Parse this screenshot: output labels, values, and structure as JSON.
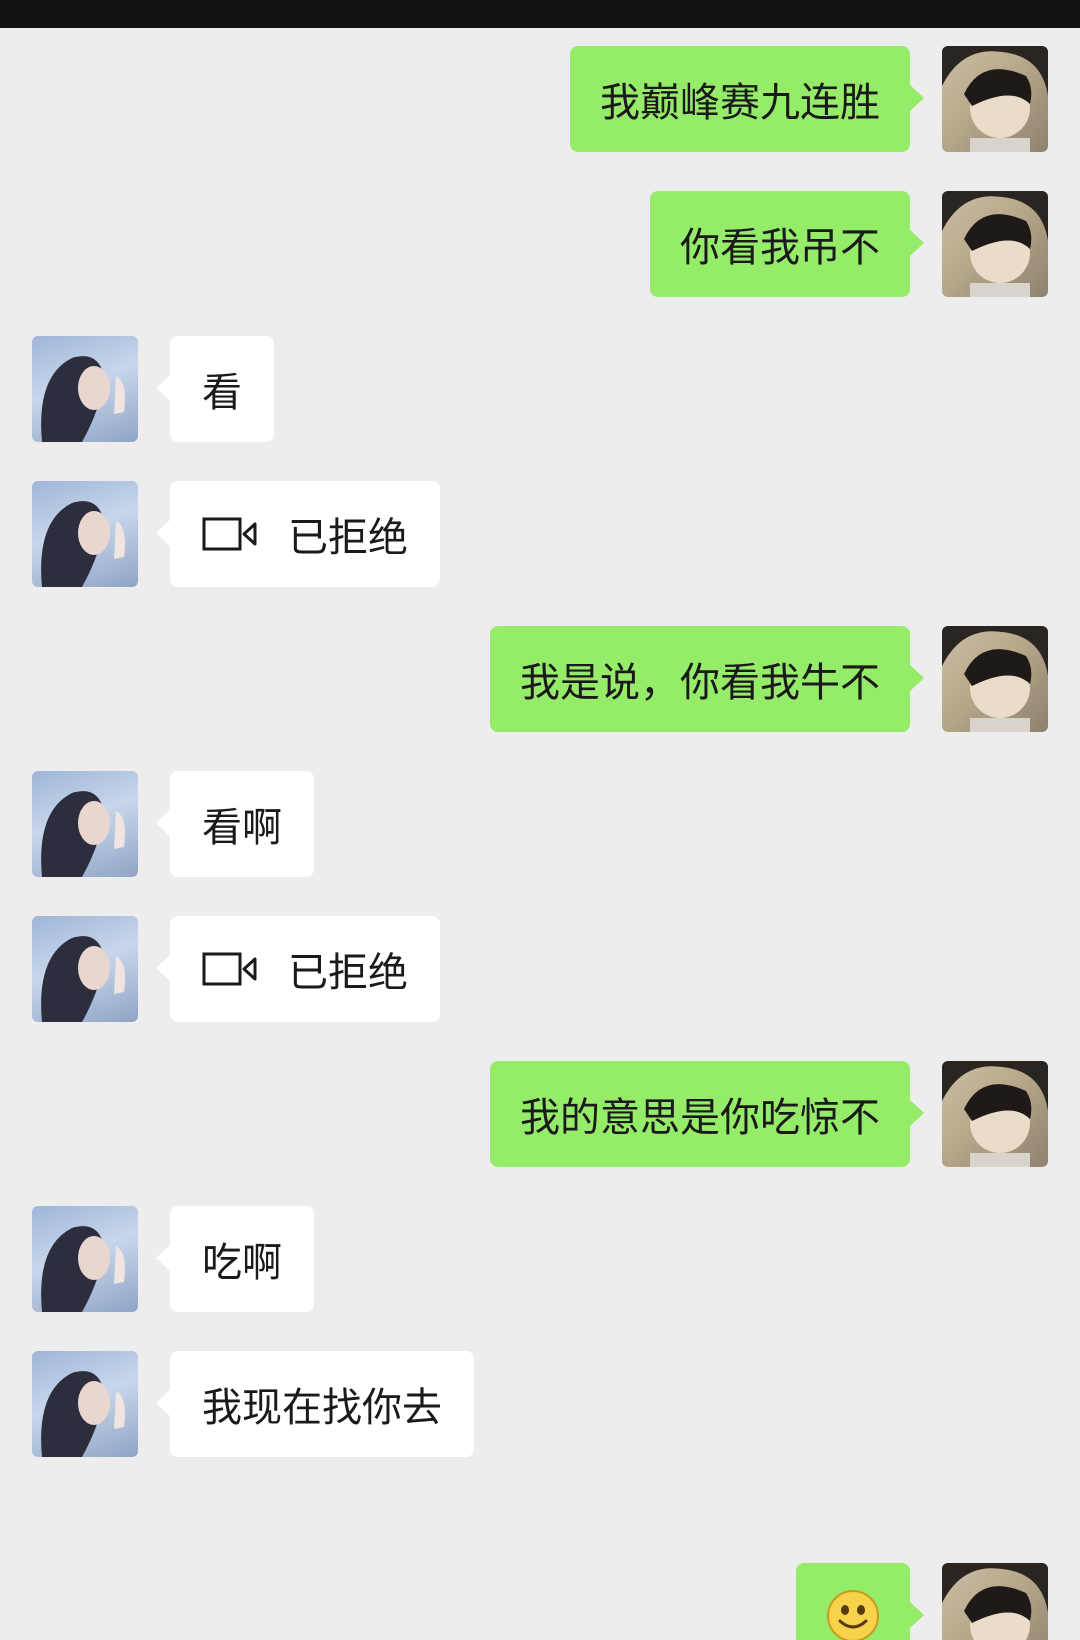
{
  "chat": {
    "messages": [
      {
        "sender": "self",
        "text": "我巅峰赛九连胜"
      },
      {
        "sender": "self",
        "text": "你看我吊不"
      },
      {
        "sender": "other",
        "text": "看"
      },
      {
        "sender": "other",
        "type": "video-call",
        "icon": "video-call-icon",
        "text": "已拒绝"
      },
      {
        "sender": "self",
        "text": "我是说，你看我牛不"
      },
      {
        "sender": "other",
        "text": "看啊"
      },
      {
        "sender": "other",
        "type": "video-call",
        "icon": "video-call-icon",
        "text": "已拒绝"
      },
      {
        "sender": "self",
        "text": "我的意思是你吃惊不"
      },
      {
        "sender": "other",
        "text": "吃啊"
      },
      {
        "sender": "other",
        "text": "我现在找你去"
      },
      {
        "sender": "self",
        "type": "emoji",
        "icon": "smile-emoji-icon"
      }
    ]
  },
  "colors": {
    "background": "#ededed",
    "self_bubble": "#95ec69",
    "other_bubble": "#ffffff",
    "status_bar": "#111111"
  }
}
